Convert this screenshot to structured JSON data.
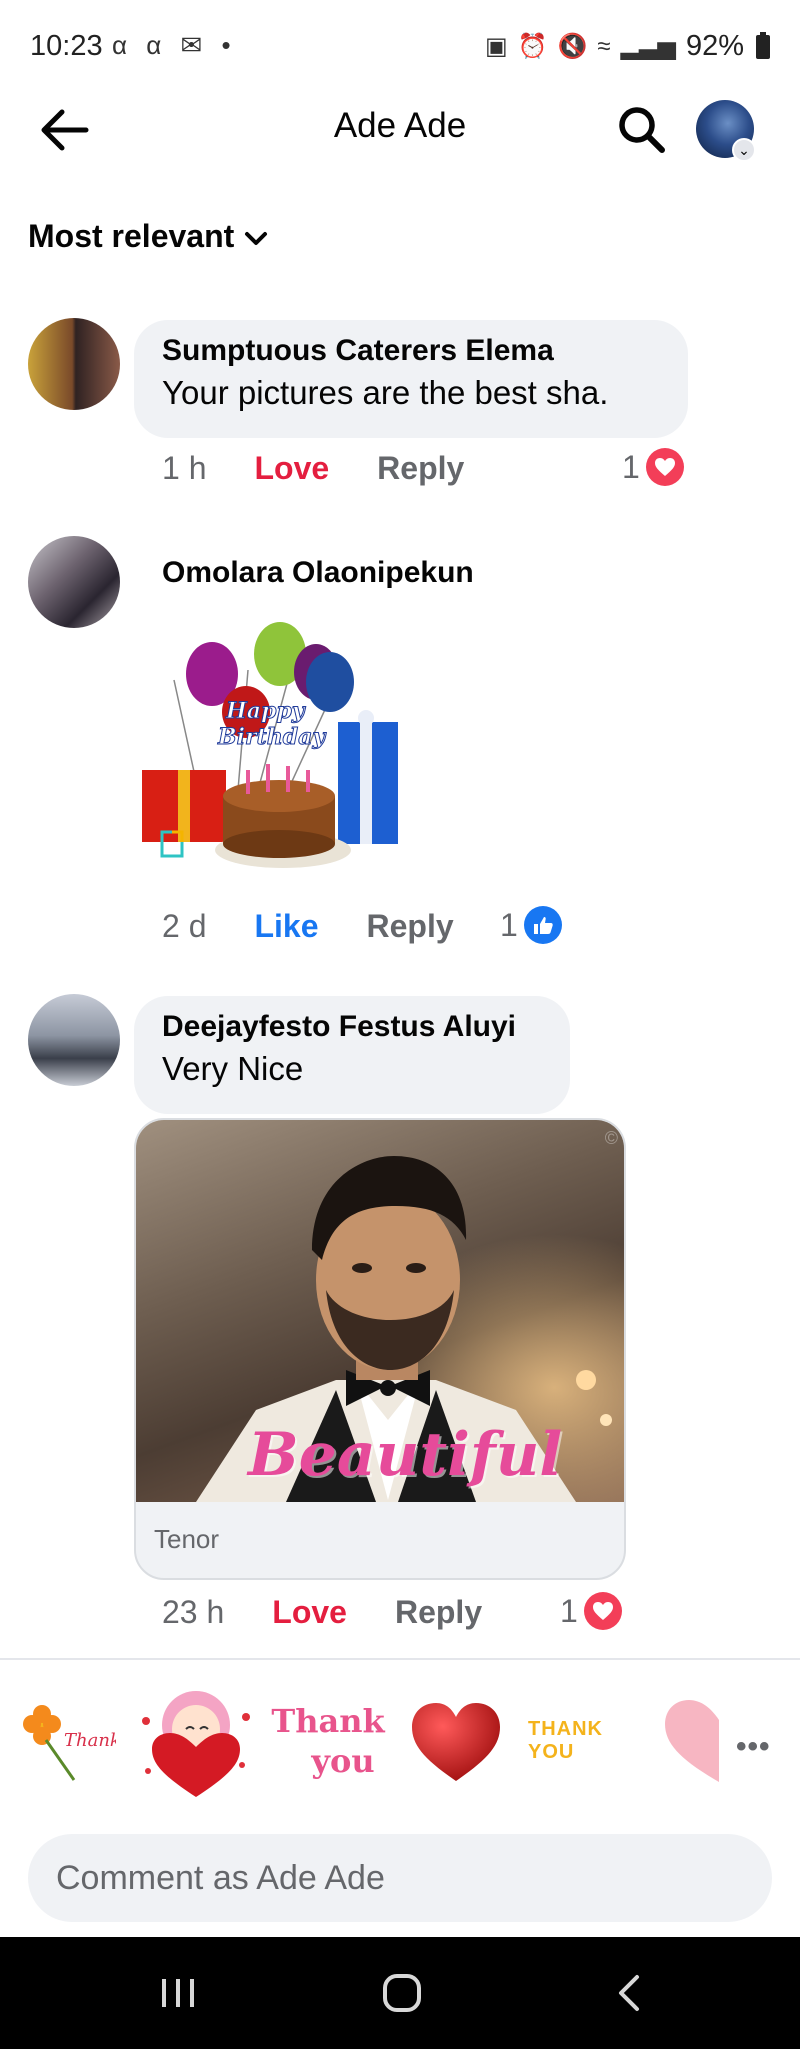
{
  "status_bar": {
    "time": "10:23",
    "left_icons": "α α ✉ •",
    "battery": "92%"
  },
  "header": {
    "title": "Ade Ade",
    "back_icon": "back-arrow-icon",
    "search_icon": "search-icon"
  },
  "sort": {
    "label": "Most relevant"
  },
  "comments": [
    {
      "author": "Sumptuous Caterers Elema",
      "text": "Your pictures are the best sha.",
      "time": "1 h",
      "reaction_label": "Love",
      "reply_label": "Reply",
      "reaction_count": "1",
      "reaction_icon": "heart-icon"
    },
    {
      "author": "Omolara Olaonipekun",
      "sticker_text": "Happy Birthday",
      "time": "2 d",
      "reaction_label": "Like",
      "reply_label": "Reply",
      "reaction_count": "1",
      "reaction_icon": "thumbs-up-icon"
    },
    {
      "author": "Deejayfesto Festus Aluyi",
      "text": "Very Nice",
      "gif_caption": "Beautiful",
      "gif_source": "Tenor",
      "time": "23 h",
      "reaction_label": "Love",
      "reply_label": "Reply",
      "reaction_count": "1",
      "reaction_icon": "heart-icon"
    }
  ],
  "suggestions": {
    "thank_you_1": "Thank You",
    "thank_you_3a": "Thank",
    "thank_you_3b": "you",
    "thank_you_5": "THANK YOU"
  },
  "composer": {
    "placeholder": "Comment as Ade Ade"
  },
  "colors": {
    "love": "#e41e3f",
    "like": "#1877f2",
    "secondary_text": "#65676b",
    "bubble": "#f0f2f5"
  }
}
